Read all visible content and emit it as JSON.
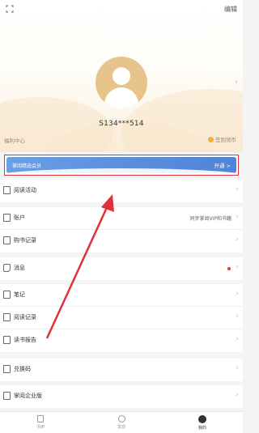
{
  "header": {
    "edit_label": "编辑",
    "username": "S134***514",
    "welfare_label": "福利中心",
    "checkin_label": "签到领币"
  },
  "vip": {
    "label": "掌阅精选会员",
    "action": "开通 >"
  },
  "menu": {
    "reading_activity": "阅读活动",
    "account": "账户",
    "account_sub": "同步掌阅VIP和书籍",
    "purchase_records": "购书记录",
    "messages": "消息",
    "notes": "笔记",
    "reading_records": "阅读记录",
    "reading_report": "读书报告",
    "redeem_code": "兑换码",
    "enterprise": "掌阅企业版"
  },
  "tabs": {
    "bookshelf": "书架",
    "discover": "发现",
    "mine": "我的"
  },
  "colors": {
    "highlight_border": "#e0303a",
    "vip_blue": "#5a8fde",
    "avatar_gold": "#e6c48b",
    "badge_red": "#e23a3a"
  }
}
